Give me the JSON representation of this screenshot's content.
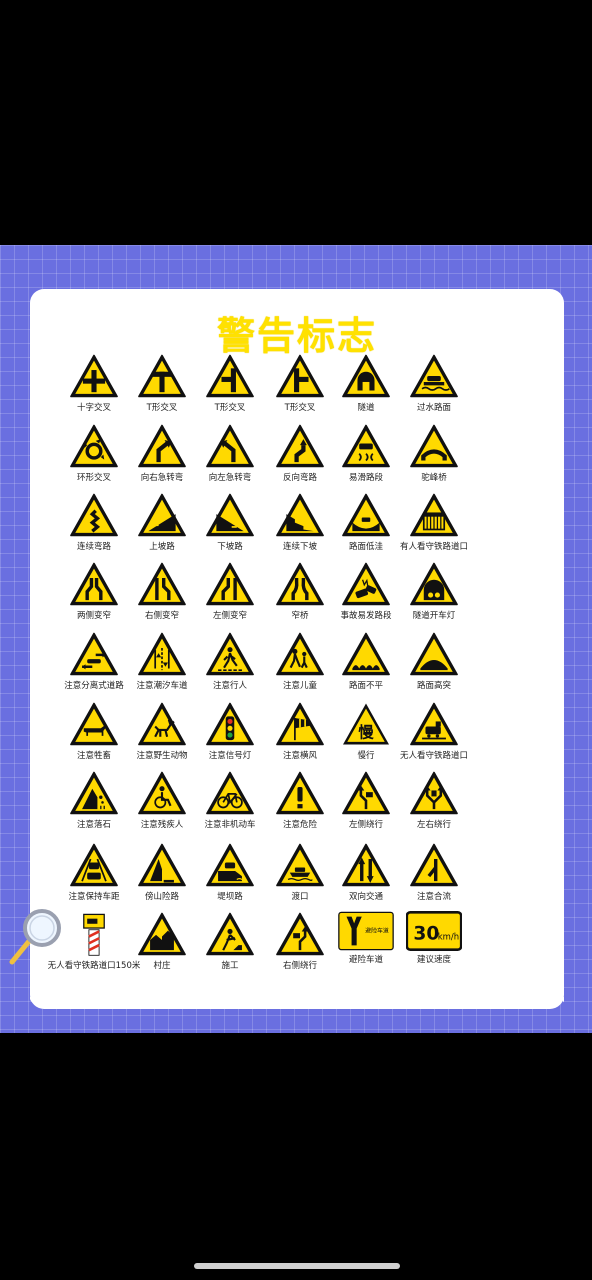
{
  "poster": {
    "title": "警告标志",
    "signs": [
      {
        "label": "十字交叉",
        "icon": "crossroads-icon"
      },
      {
        "label": "T形交叉",
        "icon": "t-junction-icon"
      },
      {
        "label": "T形交叉",
        "icon": "t-junction-left-icon"
      },
      {
        "label": "T形交叉",
        "icon": "t-junction-right-icon"
      },
      {
        "label": "隧道",
        "icon": "tunnel-icon"
      },
      {
        "label": "过水路面",
        "icon": "ford-icon"
      },
      {
        "label": "环形交叉",
        "icon": "roundabout-icon"
      },
      {
        "label": "向右急转弯",
        "icon": "sharp-right-curve-icon"
      },
      {
        "label": "向左急转弯",
        "icon": "sharp-left-curve-icon"
      },
      {
        "label": "反向弯路",
        "icon": "reverse-curve-icon"
      },
      {
        "label": "易滑路段",
        "icon": "slippery-road-icon"
      },
      {
        "label": "驼峰桥",
        "icon": "hump-bridge-icon"
      },
      {
        "label": "连续弯路",
        "icon": "winding-road-icon"
      },
      {
        "label": "上坡路",
        "icon": "uphill-icon"
      },
      {
        "label": "下坡路",
        "icon": "downhill-icon"
      },
      {
        "label": "连续下坡",
        "icon": "continuous-downhill-icon"
      },
      {
        "label": "路面低洼",
        "icon": "dip-icon"
      },
      {
        "label": "有人看守铁路道口",
        "icon": "guarded-railway-crossing-icon"
      },
      {
        "label": "两侧变窄",
        "icon": "road-narrows-both-icon"
      },
      {
        "label": "右侧变窄",
        "icon": "road-narrows-right-icon"
      },
      {
        "label": "左侧变窄",
        "icon": "road-narrows-left-icon"
      },
      {
        "label": "窄桥",
        "icon": "narrow-bridge-icon"
      },
      {
        "label": "事故易发路段",
        "icon": "accident-zone-icon"
      },
      {
        "label": "隧道开车灯",
        "icon": "tunnel-lights-icon"
      },
      {
        "label": "注意分离式道路",
        "icon": "divided-road-icon"
      },
      {
        "label": "注意潮汐车道",
        "icon": "tidal-lane-icon"
      },
      {
        "label": "注意行人",
        "icon": "pedestrians-icon"
      },
      {
        "label": "注意儿童",
        "icon": "children-icon"
      },
      {
        "label": "路面不平",
        "icon": "uneven-road-icon"
      },
      {
        "label": "路面高突",
        "icon": "road-bump-icon"
      },
      {
        "label": "注意牲畜",
        "icon": "livestock-icon"
      },
      {
        "label": "注意野生动物",
        "icon": "wild-animals-icon"
      },
      {
        "label": "注意信号灯",
        "icon": "traffic-signal-icon"
      },
      {
        "label": "注意横风",
        "icon": "crosswind-icon"
      },
      {
        "label": "慢行",
        "icon": "slow-icon",
        "text": "慢"
      },
      {
        "label": "无人看守铁路道口",
        "icon": "unguarded-railway-crossing-icon"
      },
      {
        "label": "注意落石",
        "icon": "falling-rocks-icon"
      },
      {
        "label": "注意残疾人",
        "icon": "disabled-persons-icon"
      },
      {
        "label": "注意非机动车",
        "icon": "bicycles-icon"
      },
      {
        "label": "注意危险",
        "icon": "danger-icon"
      },
      {
        "label": "左侧绕行",
        "icon": "detour-left-icon"
      },
      {
        "label": "左右绕行",
        "icon": "detour-both-icon"
      },
      {
        "label": "注意保持车距",
        "icon": "keep-distance-icon"
      },
      {
        "label": "傍山险路",
        "icon": "mountain-road-icon"
      },
      {
        "label": "堤坝路",
        "icon": "embankment-road-icon"
      },
      {
        "label": "渡口",
        "icon": "ferry-icon"
      },
      {
        "label": "双向交通",
        "icon": "two-way-traffic-icon"
      },
      {
        "label": "注意合流",
        "icon": "merging-traffic-icon"
      },
      {
        "label": "无人看守铁路道口150米",
        "icon": "railway-150m-icon"
      },
      {
        "label": "村庄",
        "icon": "village-icon"
      },
      {
        "label": "施工",
        "icon": "road-works-icon"
      },
      {
        "label": "右侧绕行",
        "icon": "detour-right-icon"
      },
      {
        "label": "避险车道",
        "icon": "escape-lane-icon",
        "text": "避险车道"
      },
      {
        "label": "建议速度",
        "icon": "advisory-speed-icon",
        "text": "30",
        "unit": "km/h"
      }
    ]
  },
  "colors": {
    "sign_yellow": "#ffd900",
    "sign_border": "#111111",
    "title_yellow": "#ffe100",
    "poster_blue": "#6a6fe0"
  }
}
